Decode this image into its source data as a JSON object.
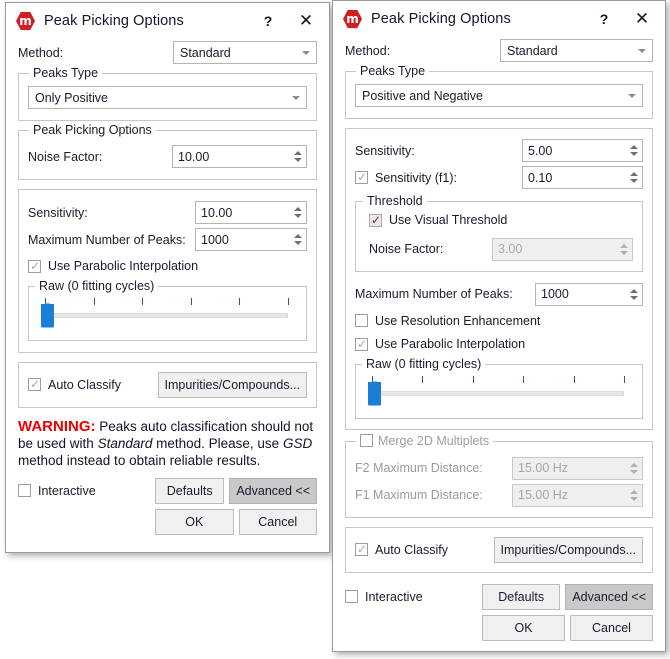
{
  "left": {
    "title": "Peak Picking Options",
    "logo_glyph": "⬣",
    "help_label": "?",
    "close_label": "✕",
    "method_label": "Method:",
    "method_value": "Standard",
    "peaks_type_group": "Peaks Type",
    "peaks_type_value": "Only Positive",
    "ppo_group": "Peak Picking Options",
    "noise_factor_label": "Noise Factor:",
    "noise_factor_value": "10.00",
    "sensitivity_label": "Sensitivity:",
    "sensitivity_value": "10.00",
    "max_peaks_label": "Maximum Number of Peaks:",
    "max_peaks_value": "1000",
    "parabolic_label": "Use Parabolic Interpolation",
    "parabolic_tick": "✓",
    "raw_group": "Raw (0 fitting cycles)",
    "auto_classify_label": "Auto Classify",
    "auto_classify_tick": "✓",
    "impurities_label": "Impurities/Compounds...",
    "warning_word": "WARNING:",
    "warning_text_1": " Peaks auto classification should not be used with ",
    "warning_em_1": "Standard",
    "warning_text_2": " method. Please, use ",
    "warning_em_2": "GSD",
    "warning_text_3": " method instead to obtain reliable results.",
    "interactive_label": "Interactive",
    "defaults_label": "Defaults",
    "advanced_label": "Advanced <<",
    "ok_label": "OK",
    "cancel_label": "Cancel"
  },
  "right": {
    "title": "Peak Picking Options",
    "logo_glyph": "⬣",
    "help_label": "?",
    "close_label": "✕",
    "method_label": "Method:",
    "method_value": "Standard",
    "peaks_type_group": "Peaks Type",
    "peaks_type_value": "Positive and Negative",
    "sensitivity_label": "Sensitivity:",
    "sensitivity_value": "5.00",
    "sensitivity_f1_label": "Sensitivity (f1):",
    "sensitivity_f1_tick": "✓",
    "sensitivity_f1_value": "0.10",
    "threshold_group": "Threshold",
    "visual_threshold_label": "Use Visual Threshold",
    "visual_threshold_tick": "✓",
    "noise_factor_label": "Noise Factor:",
    "noise_factor_value": "3.00",
    "max_peaks_label": "Maximum Number of Peaks:",
    "max_peaks_value": "1000",
    "resolution_label": "Use Resolution Enhancement",
    "parabolic_label": "Use Parabolic Interpolation",
    "parabolic_tick": "✓",
    "raw_group": "Raw (0 fitting cycles)",
    "merge_group": "Merge 2D Multiplets",
    "f2_label": "F2 Maximum Distance:",
    "f2_value": "15.00 Hz",
    "f1_label": "F1 Maximum Distance:",
    "f1_value": "15.00 Hz",
    "auto_classify_label": "Auto Classify",
    "auto_classify_tick": "✓",
    "impurities_label": "Impurities/Compounds...",
    "interactive_label": "Interactive",
    "defaults_label": "Defaults",
    "advanced_label": "Advanced <<",
    "ok_label": "OK",
    "cancel_label": "Cancel"
  },
  "colors": {
    "accent_red": "#cf1f26",
    "warning_red": "#ee0000",
    "slider_blue": "#1a7fd4",
    "tick_blue": "#2555a5",
    "button_face": "#f0f0f0",
    "button_pressed": "#c9c9c9"
  }
}
